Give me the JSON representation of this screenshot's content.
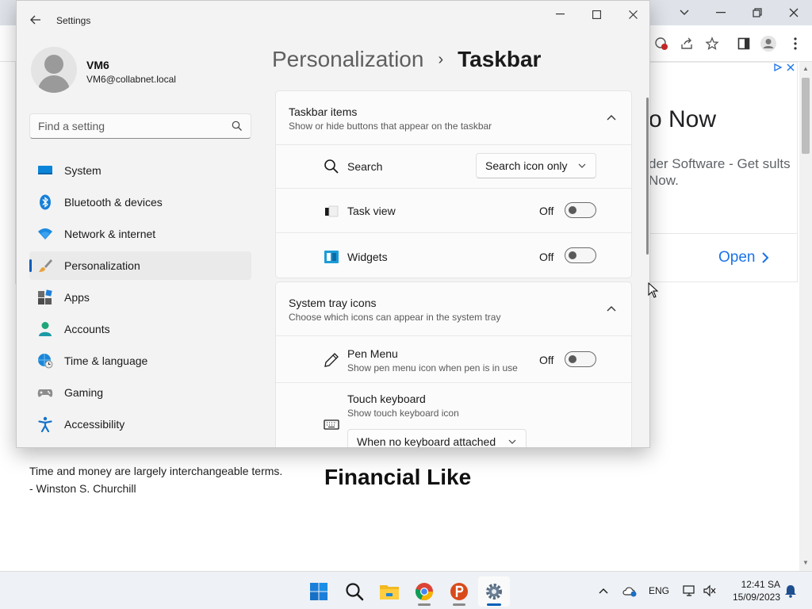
{
  "browser": {
    "ad": {
      "headline": "o Now",
      "description": "der Software - Get sults Now.",
      "open_label": "Open"
    },
    "quote_line1": "Time and money are largely interchangeable terms.",
    "quote_line2": "- Winston S. Churchill",
    "heading": "Financial Like"
  },
  "settings": {
    "window_title": "Settings",
    "user": {
      "name": "VM6",
      "email": "VM6@collabnet.local"
    },
    "search": {
      "placeholder": "Find a setting"
    },
    "nav": [
      {
        "label": "System",
        "icon": "system-icon"
      },
      {
        "label": "Bluetooth & devices",
        "icon": "bluetooth-icon"
      },
      {
        "label": "Network & internet",
        "icon": "wifi-icon"
      },
      {
        "label": "Personalization",
        "icon": "brush-icon",
        "active": true
      },
      {
        "label": "Apps",
        "icon": "apps-icon"
      },
      {
        "label": "Accounts",
        "icon": "accounts-icon"
      },
      {
        "label": "Time & language",
        "icon": "globe-clock-icon"
      },
      {
        "label": "Gaming",
        "icon": "gamepad-icon"
      },
      {
        "label": "Accessibility",
        "icon": "accessibility-icon"
      }
    ],
    "breadcrumb": {
      "parent": "Personalization",
      "separator": "›",
      "current": "Taskbar"
    },
    "taskbar_items": {
      "title": "Taskbar items",
      "subtitle": "Show or hide buttons that appear on the taskbar",
      "search": {
        "label": "Search",
        "value": "Search icon only"
      },
      "task_view": {
        "label": "Task view",
        "state": "Off"
      },
      "widgets": {
        "label": "Widgets",
        "state": "Off"
      }
    },
    "system_tray": {
      "title": "System tray icons",
      "subtitle": "Choose which icons can appear in the system tray",
      "pen_menu": {
        "label": "Pen Menu",
        "description": "Show pen menu icon when pen is in use",
        "state": "Off"
      },
      "touch_keyboard": {
        "label": "Touch keyboard",
        "description": "Show touch keyboard icon",
        "value": "When no keyboard attached"
      }
    }
  },
  "taskbar": {
    "language": "ENG",
    "time": "12:41 SA",
    "date": "15/09/2023"
  },
  "colors": {
    "accent": "#005fb8",
    "link": "#1a73e8"
  }
}
